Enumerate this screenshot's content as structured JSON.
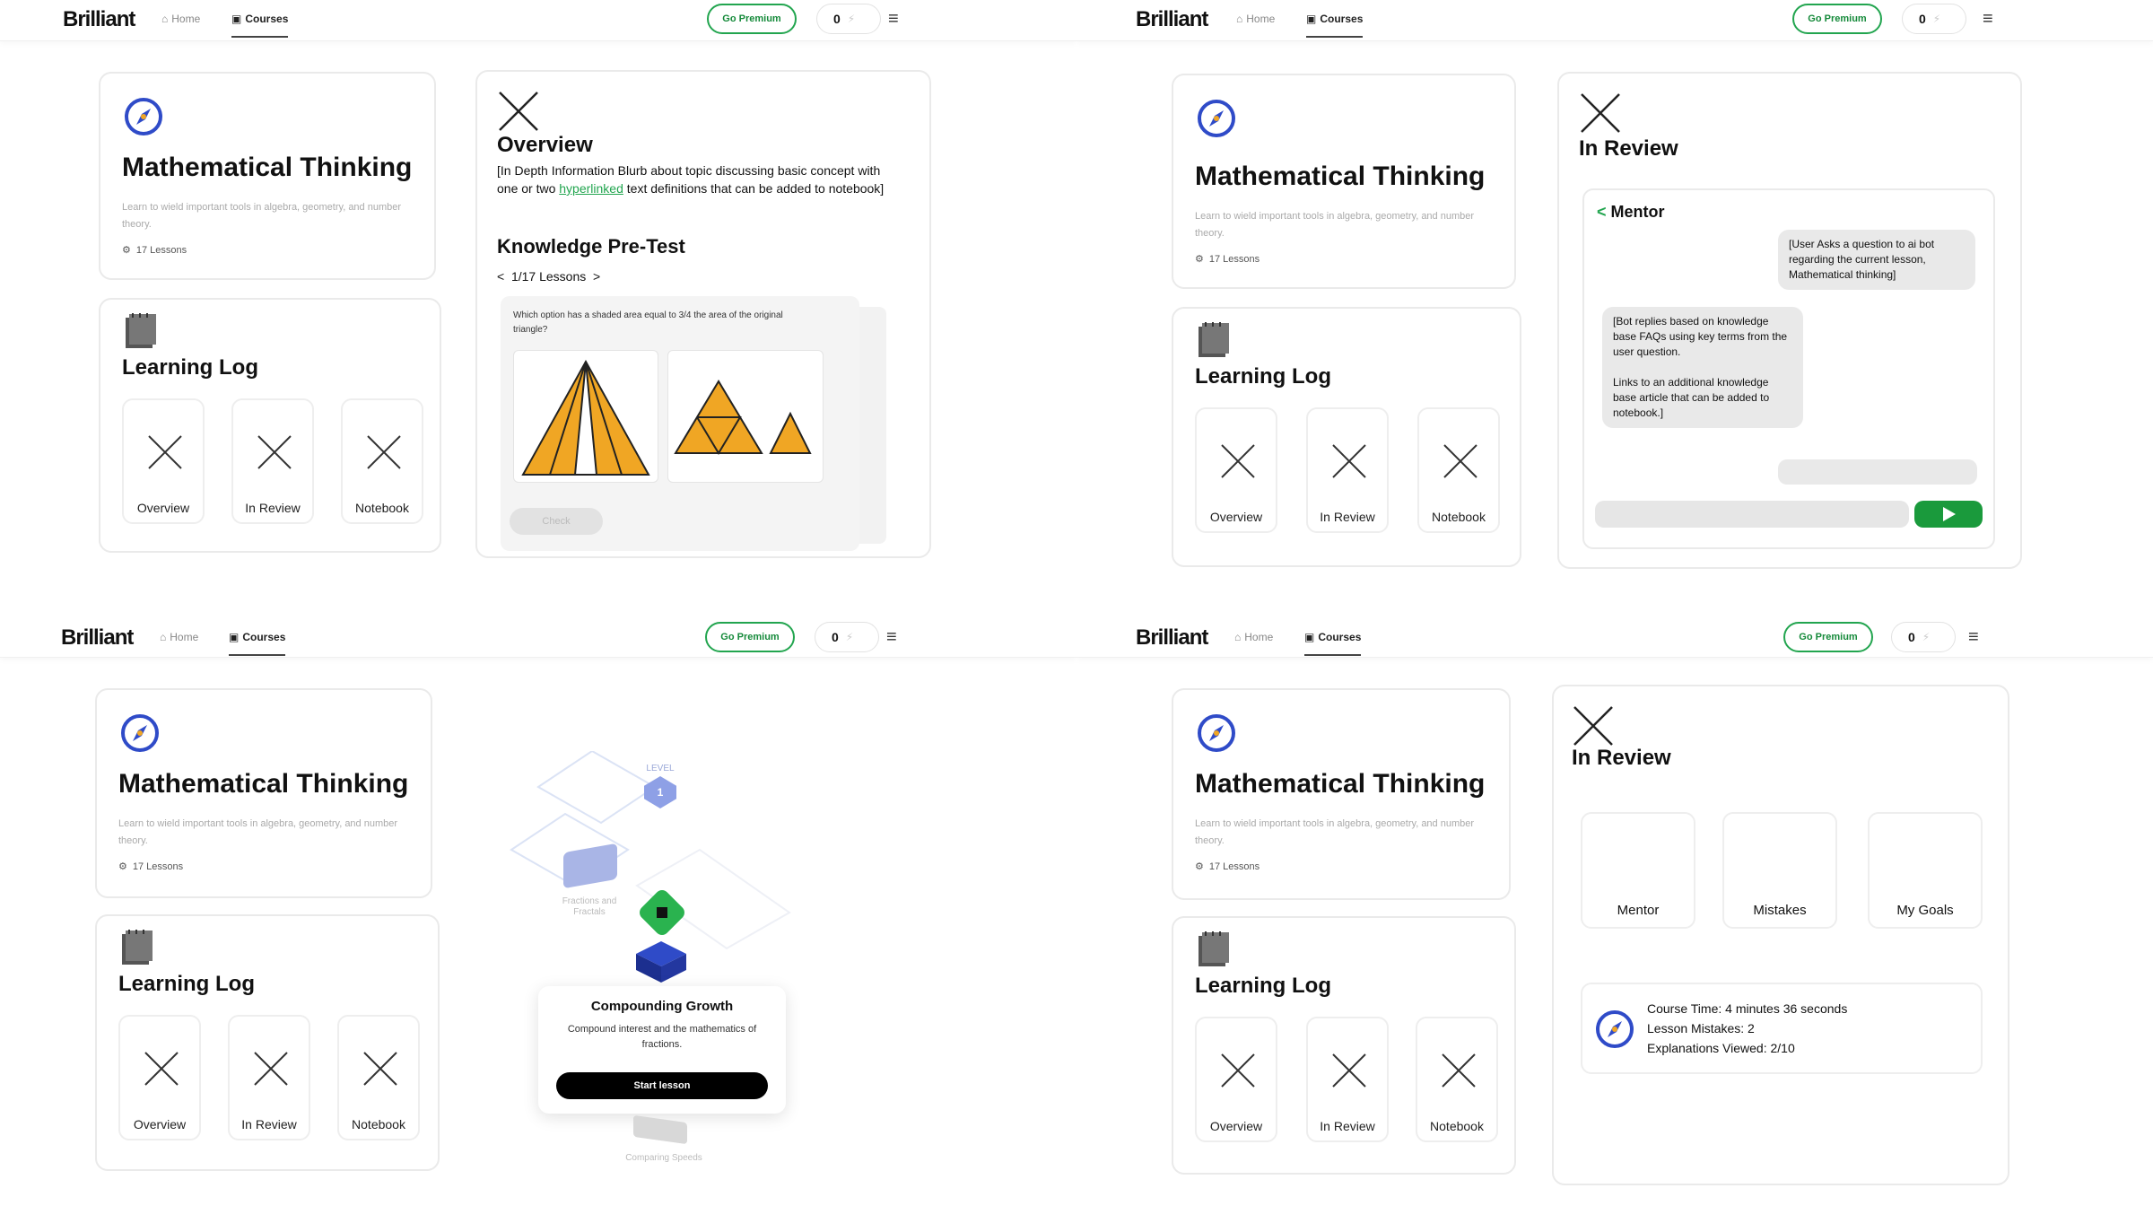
{
  "nav": {
    "logo": "Brilliant",
    "home": "Home",
    "courses": "Courses",
    "premium": "Go Premium",
    "streak": "0"
  },
  "course": {
    "title": "Mathematical Thinking",
    "description": "Learn to wield important tools in algebra, geometry, and number theory.",
    "lessons": "17 Lessons"
  },
  "learning_log": {
    "title": "Learning Log",
    "tiles": [
      "Overview",
      "In Review",
      "Notebook"
    ]
  },
  "overview_panel": {
    "title": "Overview",
    "text_before": "[In Depth Information Blurb about topic discussing basic concept with one or two ",
    "link": "hyperlinked",
    "text_after": " text definitions that can be added to notebook]",
    "pretest_title": "Knowledge Pre-Test",
    "pager": "1/17 Lessons",
    "question": "Which option has a shaded area equal to 3/4 the area of the original triangle?",
    "check": "Check"
  },
  "mentor_panel": {
    "title": "In Review",
    "mentor_back": "Mentor",
    "user_msg": "[User Asks a question to ai bot regarding the current lesson, Mathematical thinking]",
    "bot_msg_1": "[Bot replies based on knowledge base FAQs using key terms from the user question.",
    "bot_msg_2": "Links to an additional knowledge base article that can be added to notebook.]"
  },
  "path_panel": {
    "level": "LEVEL",
    "level_num": "1",
    "node_label": "Fractions and Fractals",
    "popup_title": "Compounding Growth",
    "popup_desc": "Compound interest and the mathematics of fractions.",
    "popup_button": "Start lesson",
    "next_label": "Comparing Speeds"
  },
  "review_panel": {
    "title": "In Review",
    "tiles": [
      "Mentor",
      "Mistakes",
      "My Goals"
    ],
    "stats": [
      "Course Time: 4 minutes 36 seconds",
      "Lesson Mistakes: 2",
      "Explanations Viewed: 2/10"
    ]
  },
  "colors": {
    "brand_green": "#22a54f",
    "triangle_orange": "#f0a624",
    "node_blue": "#2f4bc8"
  }
}
